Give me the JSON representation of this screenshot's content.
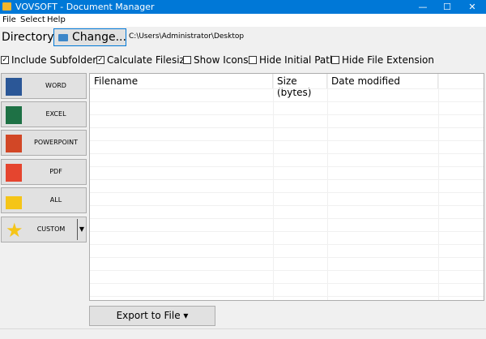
{
  "window": {
    "title": "VOVSOFT - Document Manager",
    "min": "—",
    "max": "☐",
    "close": "✕"
  },
  "menu": [
    "File",
    "Select",
    "Help"
  ],
  "directory": {
    "label": "Directory:",
    "button": "Change...",
    "path": "C:\\Users\\Administrator\\Desktop"
  },
  "options": [
    {
      "label": "Include Subfolders",
      "checked": true
    },
    {
      "label": "Calculate Filesize",
      "checked": true
    },
    {
      "label": "Show Icons",
      "checked": false
    },
    {
      "label": "Hide Initial Path",
      "checked": false
    },
    {
      "label": "Hide File Extension",
      "checked": false
    }
  ],
  "types": [
    {
      "label": "WORD",
      "color": "#2b5797"
    },
    {
      "label": "EXCEL",
      "color": "#1e7145"
    },
    {
      "label": "POWERPOINT",
      "color": "#d24726"
    },
    {
      "label": "PDF",
      "color": "#e5452f"
    },
    {
      "label": "ALL",
      "color": "#f5c518"
    },
    {
      "label": "CUSTOM",
      "color": "#f5c518"
    }
  ],
  "table": {
    "columns": [
      "Filename",
      "Size (bytes)",
      "Date modified"
    ],
    "rows": []
  },
  "export": {
    "label": "Export to File ▾"
  },
  "check_mark": "✓"
}
